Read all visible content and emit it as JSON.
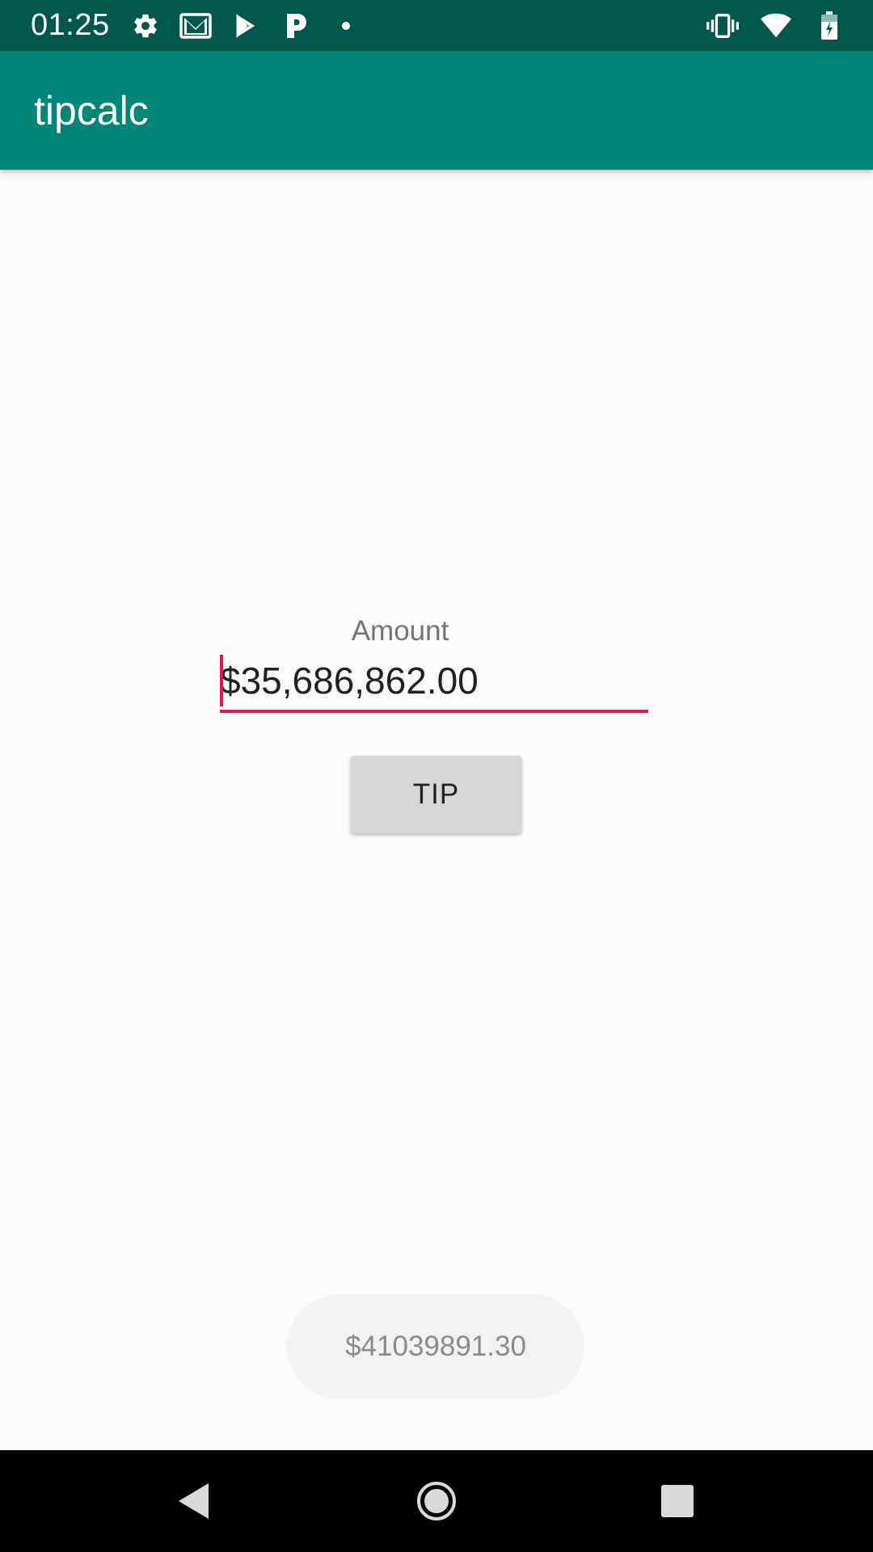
{
  "status_bar": {
    "time": "01:25",
    "left_icons": [
      "gear-icon",
      "gmail-icon",
      "play-store-icon",
      "parking-p-icon",
      "dot-icon"
    ],
    "right_icons": [
      "vibrate-icon",
      "wifi-icon",
      "battery-charging-icon"
    ]
  },
  "app_bar": {
    "title": "tipcalc",
    "color": "#008577",
    "status_color": "#00574b"
  },
  "form": {
    "amount_label": "Amount",
    "amount_value": "$35,686,862.00",
    "accent_color": "#d81b60",
    "tip_button_label": "TIP"
  },
  "toast": {
    "message": "$41039891.30"
  },
  "nav_bar": {
    "buttons": [
      "back-icon",
      "home-icon",
      "recents-icon"
    ]
  }
}
